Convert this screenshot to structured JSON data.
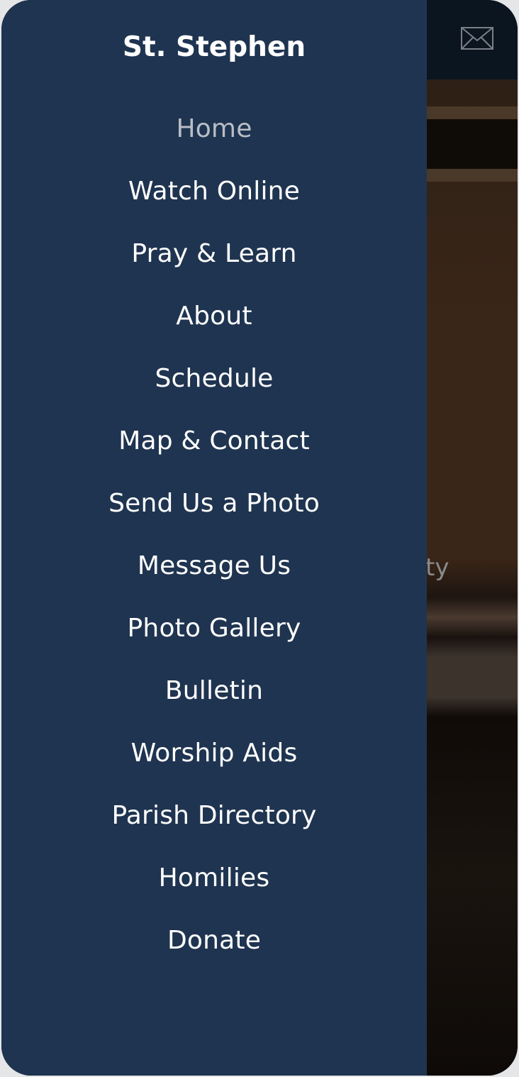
{
  "drawer": {
    "title": "St. Stephen",
    "active_index": 0,
    "items": [
      {
        "label": "Home"
      },
      {
        "label": "Watch Online"
      },
      {
        "label": "Pray & Learn"
      },
      {
        "label": "About"
      },
      {
        "label": "Schedule"
      },
      {
        "label": "Map & Contact"
      },
      {
        "label": "Send Us a Photo"
      },
      {
        "label": "Message Us"
      },
      {
        "label": "Photo Gallery"
      },
      {
        "label": "Bulletin"
      },
      {
        "label": "Worship Aids"
      },
      {
        "label": "Parish Directory"
      },
      {
        "label": "Homilies"
      },
      {
        "label": "Donate"
      }
    ]
  },
  "background_page": {
    "header_icon": "envelope-icon",
    "hero_text_fragment": "ty"
  },
  "colors": {
    "drawer_bg": "#1f3450",
    "active_item": "#b9bec6",
    "item": "#ffffff"
  }
}
